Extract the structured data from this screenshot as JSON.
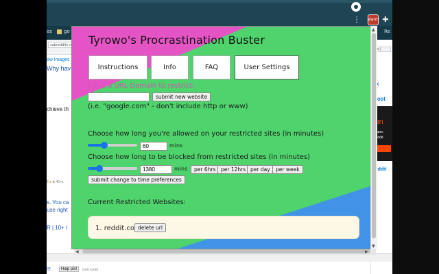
{
  "popup": {
    "title": "Tyrowo's Procrastination Buster",
    "tabs": [
      "Instructions",
      "Info",
      "FAQ",
      "User Settings"
    ],
    "restrict_label": "Input a URL Domain to restrict:",
    "restrict_input_value": "",
    "submit_website_label": "submit new website",
    "restrict_hint": "(i.e. \"google.com\" - don't include http or www)",
    "allowed_label": "Choose how long you're allowed on your restricted sites (in minutes)",
    "allowed_value": "60",
    "allowed_unit": "mins",
    "allowed_slider_fraction": 0.3,
    "blocked_label": "Choose how long to be blocked from restricted sites (in minutes)",
    "blocked_value": "1380",
    "blocked_unit": "mins",
    "blocked_slider_fraction": 0.2,
    "preset_buttons": [
      "per 6hrs",
      "per 12hrs",
      "per day",
      "per week"
    ],
    "submit_time_label": "submit change to time preferences",
    "current_heading": "Current Restricted Websites:",
    "restricted_sites": [
      {
        "index": "1.",
        "url": "reddit.com",
        "delete_label": "delete url"
      }
    ]
  },
  "background": {
    "bookmarks_left": [
      "es",
      "go"
    ],
    "bookmark_right": "Re",
    "reddit_pill": "subreddits me",
    "right_pill": "ces | ",
    "left_snippets": [
      "ow images",
      "Why hav",
      "chieve th",
      "2",
      "s. You ca",
      "use right",
      "R | 10+ I",
      "<]",
      "!!!"
    ],
    "left_small_meta": "& 40 m",
    "help_button": "Halp pls!",
    "self_code": "(self.code)",
    "right_snippets": [
      "k",
      "post",
      "iun",
      "h spec",
      "Reddit.",
      "m",
      "reddit"
    ],
    "extension_badge": "alarm"
  },
  "colors": {
    "pink": "#e554c4",
    "green": "#4fd36d",
    "blue": "#4193e8",
    "chrome_dark": "#1f4453",
    "reddit_orange": "#ff4500"
  }
}
